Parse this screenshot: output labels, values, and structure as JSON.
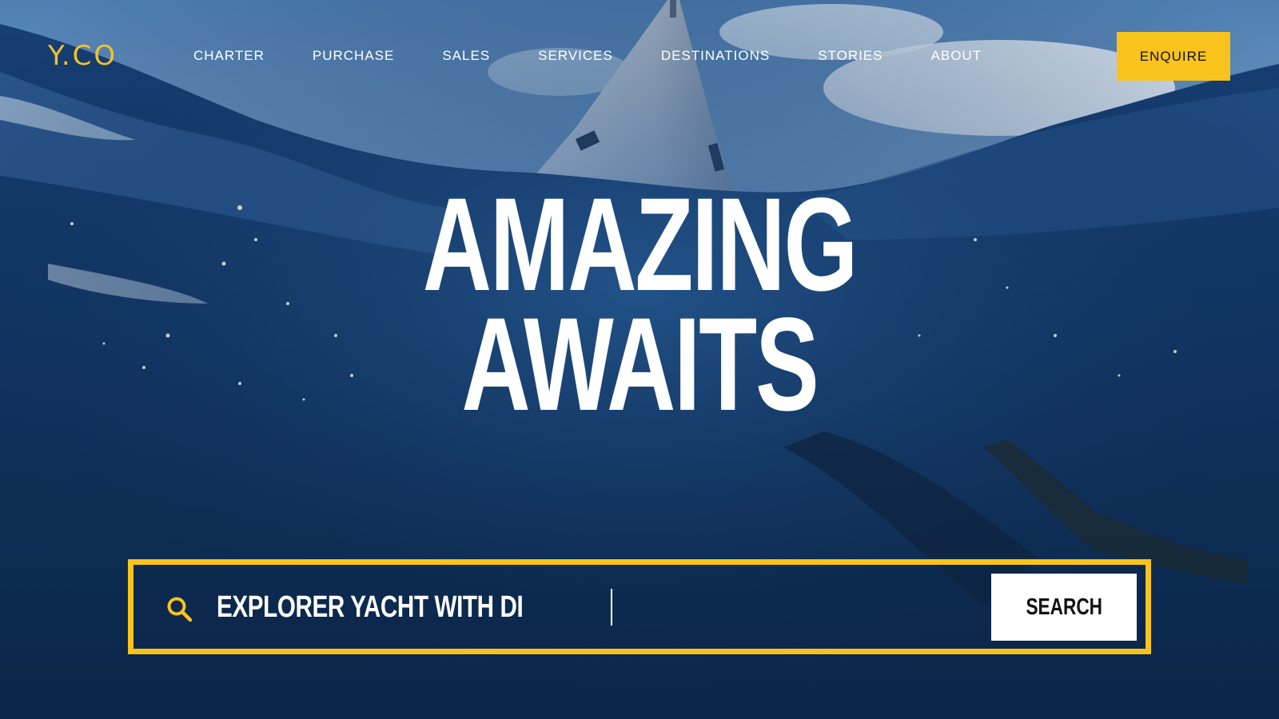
{
  "header": {
    "logo_text": "Y.CO",
    "nav": [
      {
        "label": "CHARTER"
      },
      {
        "label": "PURCHASE"
      },
      {
        "label": "SALES"
      },
      {
        "label": "SERVICES"
      },
      {
        "label": "DESTINATIONS"
      },
      {
        "label": "STORIES"
      },
      {
        "label": "ABOUT"
      }
    ],
    "enquire_label": "ENQUIRE"
  },
  "hero": {
    "headline_line1": "AMAZING",
    "headline_line2": "AWAITS"
  },
  "search": {
    "value": "EXPLORER YACHT WITH DI",
    "button_label": "SEARCH",
    "icon": "search-icon"
  },
  "colors": {
    "accent": "#f8c31d",
    "logo": "#f2c12e",
    "water_dark": "#0a2a52",
    "sky": "#5c86b4"
  }
}
